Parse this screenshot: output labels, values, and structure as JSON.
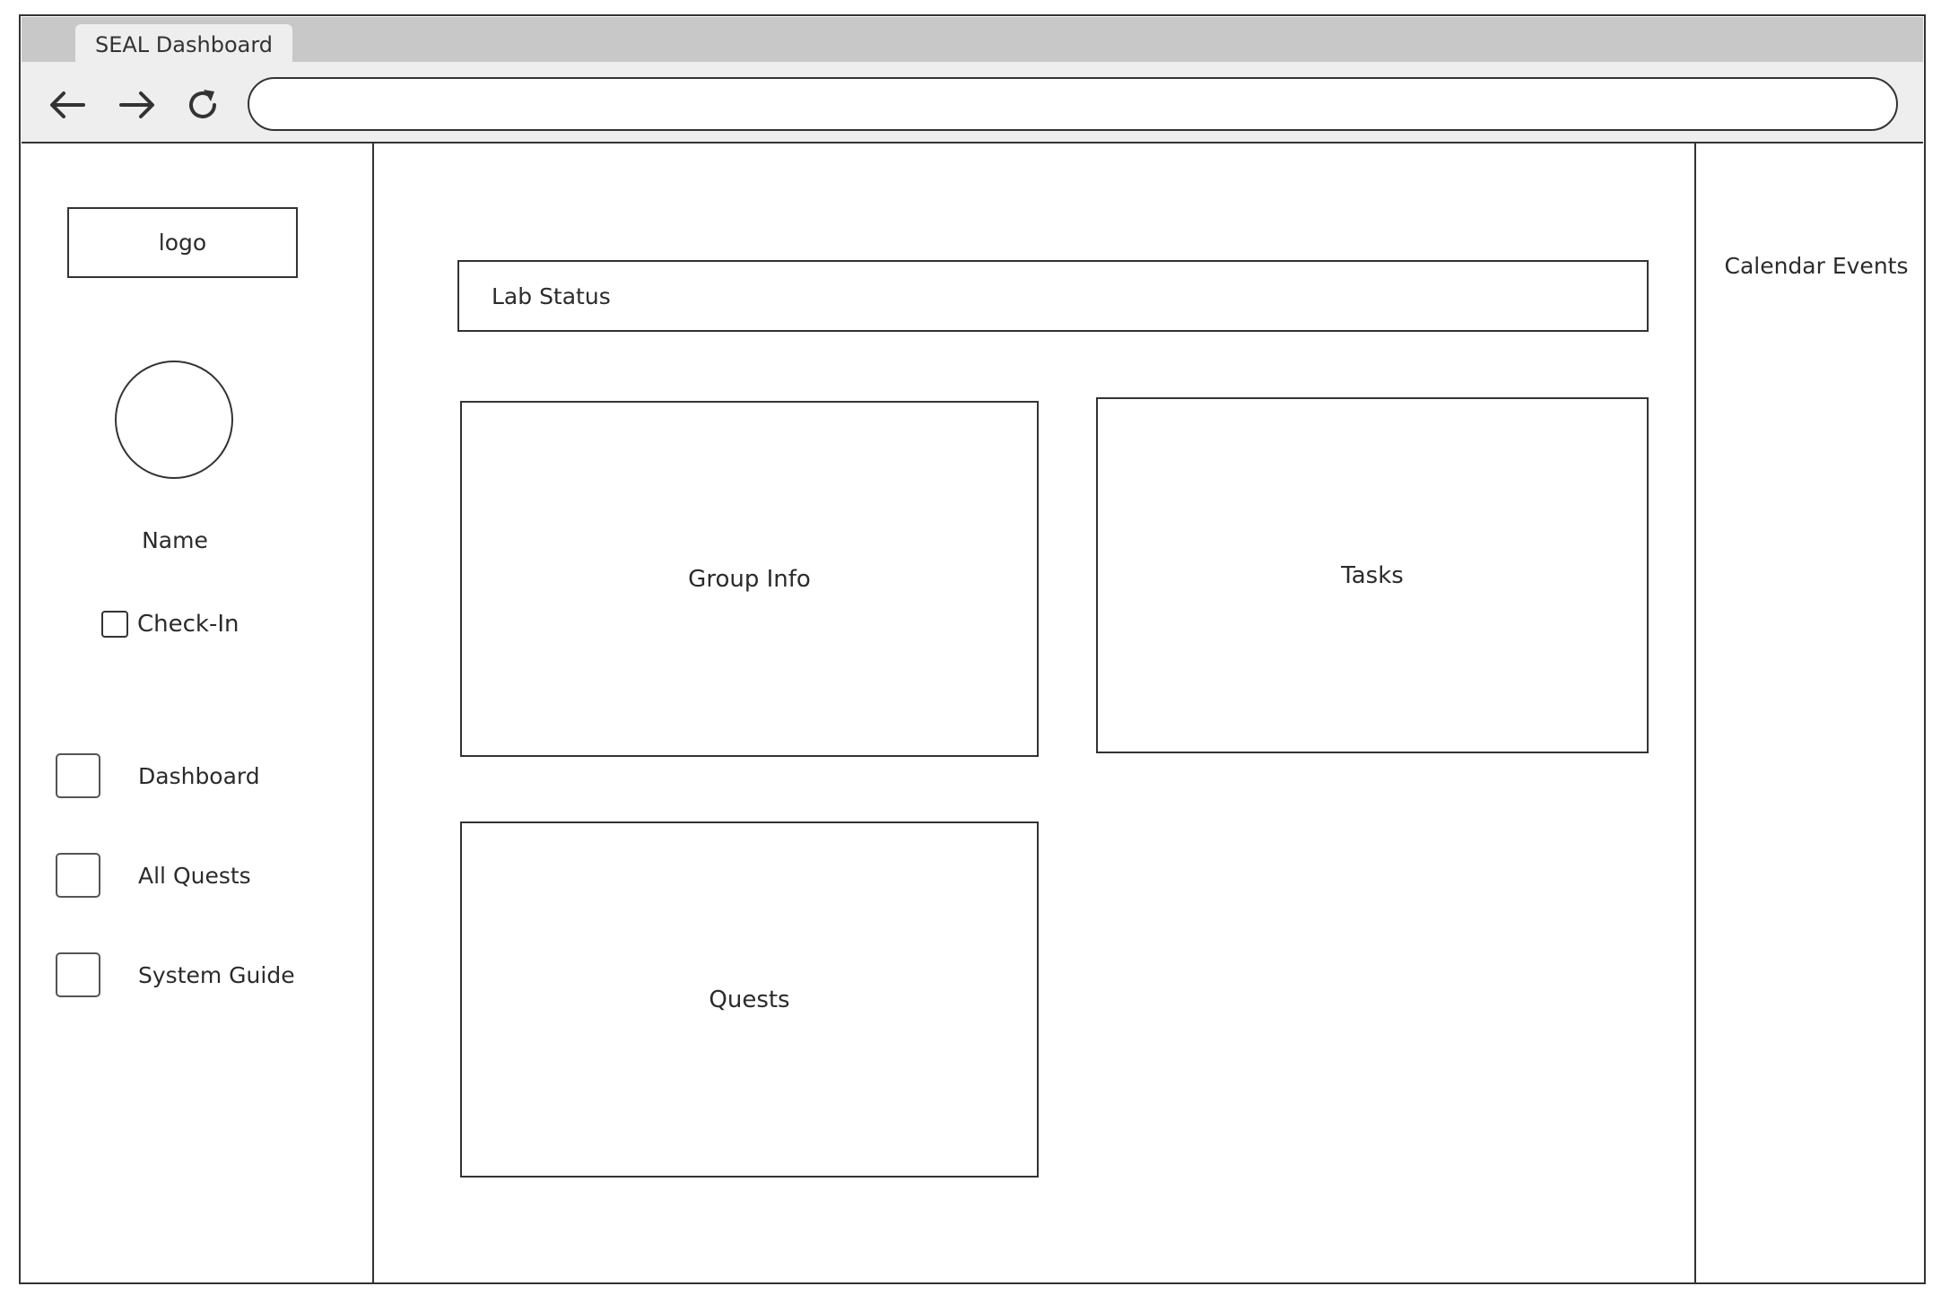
{
  "browser": {
    "tab_title": "SEAL Dashboard",
    "url": ""
  },
  "sidebar": {
    "logo_label": "logo",
    "user_name": "Name",
    "check_in_label": "Check-In",
    "nav_items": [
      {
        "label": "Dashboard"
      },
      {
        "label": "All Quests"
      },
      {
        "label": "System Guide"
      }
    ]
  },
  "main": {
    "lab_status_label": "Lab Status",
    "group_info_label": "Group Info",
    "tasks_label": "Tasks",
    "quests_label": "Quests"
  },
  "right_panel": {
    "title": "Calendar Events"
  }
}
